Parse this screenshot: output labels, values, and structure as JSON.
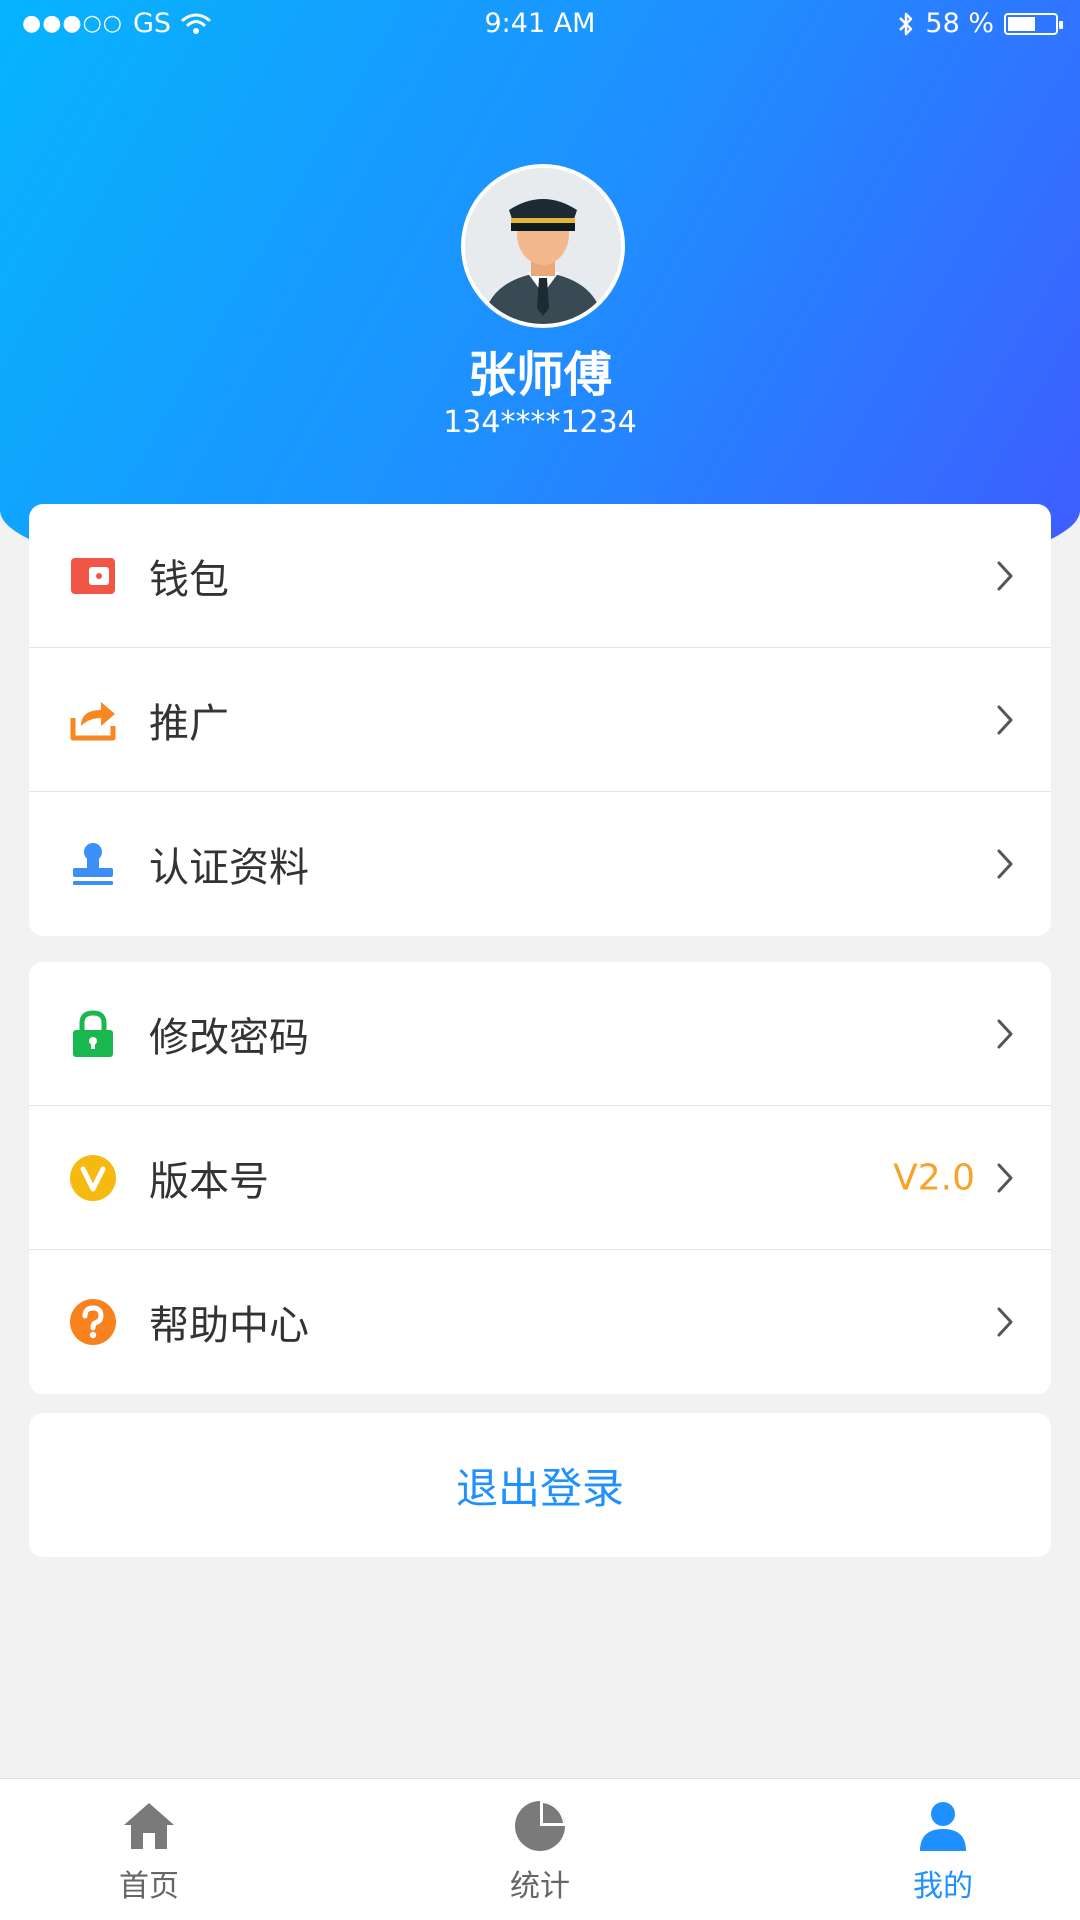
{
  "status_bar": {
    "signal": "●●●○○",
    "carrier": "GS",
    "time": "9:41 AM",
    "battery": "58 %",
    "battery_level": 0.58
  },
  "profile": {
    "name": "张师傅",
    "phone": "134****1234"
  },
  "menu_group_1": [
    {
      "label": "钱包",
      "icon": "wallet-icon"
    },
    {
      "label": "推广",
      "icon": "share-icon"
    },
    {
      "label": "认证资料",
      "icon": "certification-stamp-icon"
    }
  ],
  "menu_group_2": [
    {
      "label": "修改密码",
      "icon": "lock-icon",
      "value": ""
    },
    {
      "label": "版本号",
      "icon": "version-v-icon",
      "value": "V2.0"
    },
    {
      "label": "帮助中心",
      "icon": "help-icon",
      "value": ""
    }
  ],
  "logout_label": "退出登录",
  "tabbar": [
    {
      "label": "首页",
      "icon": "home-icon"
    },
    {
      "label": "统计",
      "icon": "pie-chart-icon"
    },
    {
      "label": "我的",
      "icon": "user-icon",
      "active": true
    }
  ],
  "colors": {
    "accent": "#1e90ff",
    "gradient_start": "#06b4fd",
    "gradient_end": "#3f5bff",
    "version_text": "#f7a32a"
  }
}
